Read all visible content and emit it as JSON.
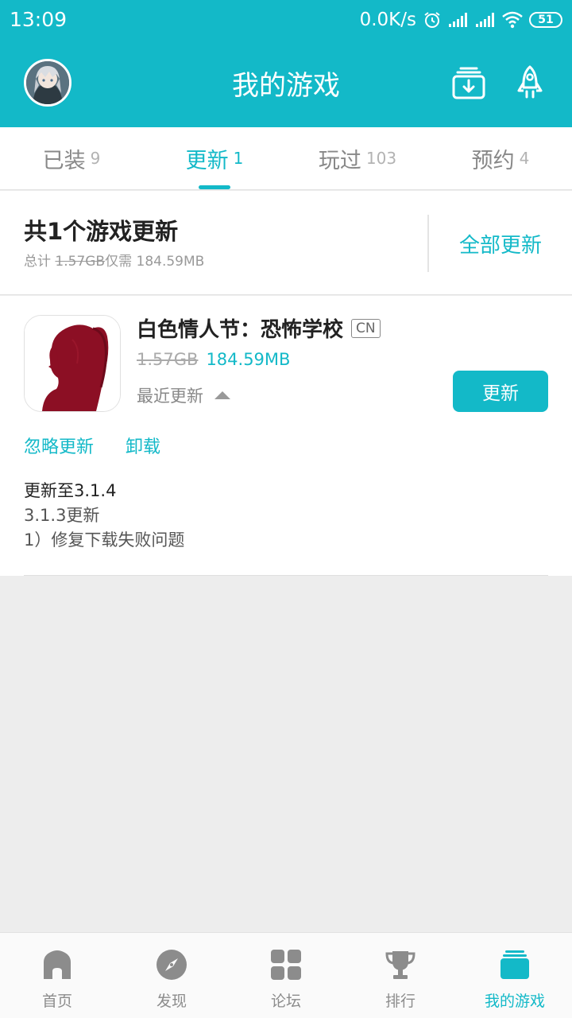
{
  "status_bar": {
    "time": "13:09",
    "speed": "0.0K/s",
    "battery": "51"
  },
  "header": {
    "title": "我的游戏"
  },
  "tabs": [
    {
      "label": "已装",
      "count": "9",
      "active": false
    },
    {
      "label": "更新",
      "count": "1",
      "active": true
    },
    {
      "label": "玩过",
      "count": "103",
      "active": false
    },
    {
      "label": "预约",
      "count": "4",
      "active": false
    }
  ],
  "summary": {
    "title": "共1个游戏更新",
    "total_prefix": "总计",
    "total_old": "1.57GB",
    "total_mid": "仅需",
    "total_new": "184.59MB",
    "update_all": "全部更新"
  },
  "game": {
    "name": "白色情人节：恐怖学校",
    "region_tag": "CN",
    "size_old": "1.57GB",
    "size_new": "184.59MB",
    "recent_label": "最近更新",
    "update_button": "更新",
    "ignore_label": "忽略更新",
    "uninstall_label": "卸载",
    "notes": [
      "更新至3.1.4",
      "3.1.3更新",
      "1）修复下载失败问题"
    ]
  },
  "bottom_nav": [
    {
      "label": "首页",
      "icon": "home-icon",
      "active": false
    },
    {
      "label": "发现",
      "icon": "compass-icon",
      "active": false
    },
    {
      "label": "论坛",
      "icon": "grid-icon",
      "active": false
    },
    {
      "label": "排行",
      "icon": "trophy-icon",
      "active": false
    },
    {
      "label": "我的游戏",
      "icon": "my-games-icon",
      "active": true
    }
  ],
  "colors": {
    "accent": "#13b9c8",
    "background": "#ededed",
    "nav_inactive": "#8c8c8c"
  }
}
